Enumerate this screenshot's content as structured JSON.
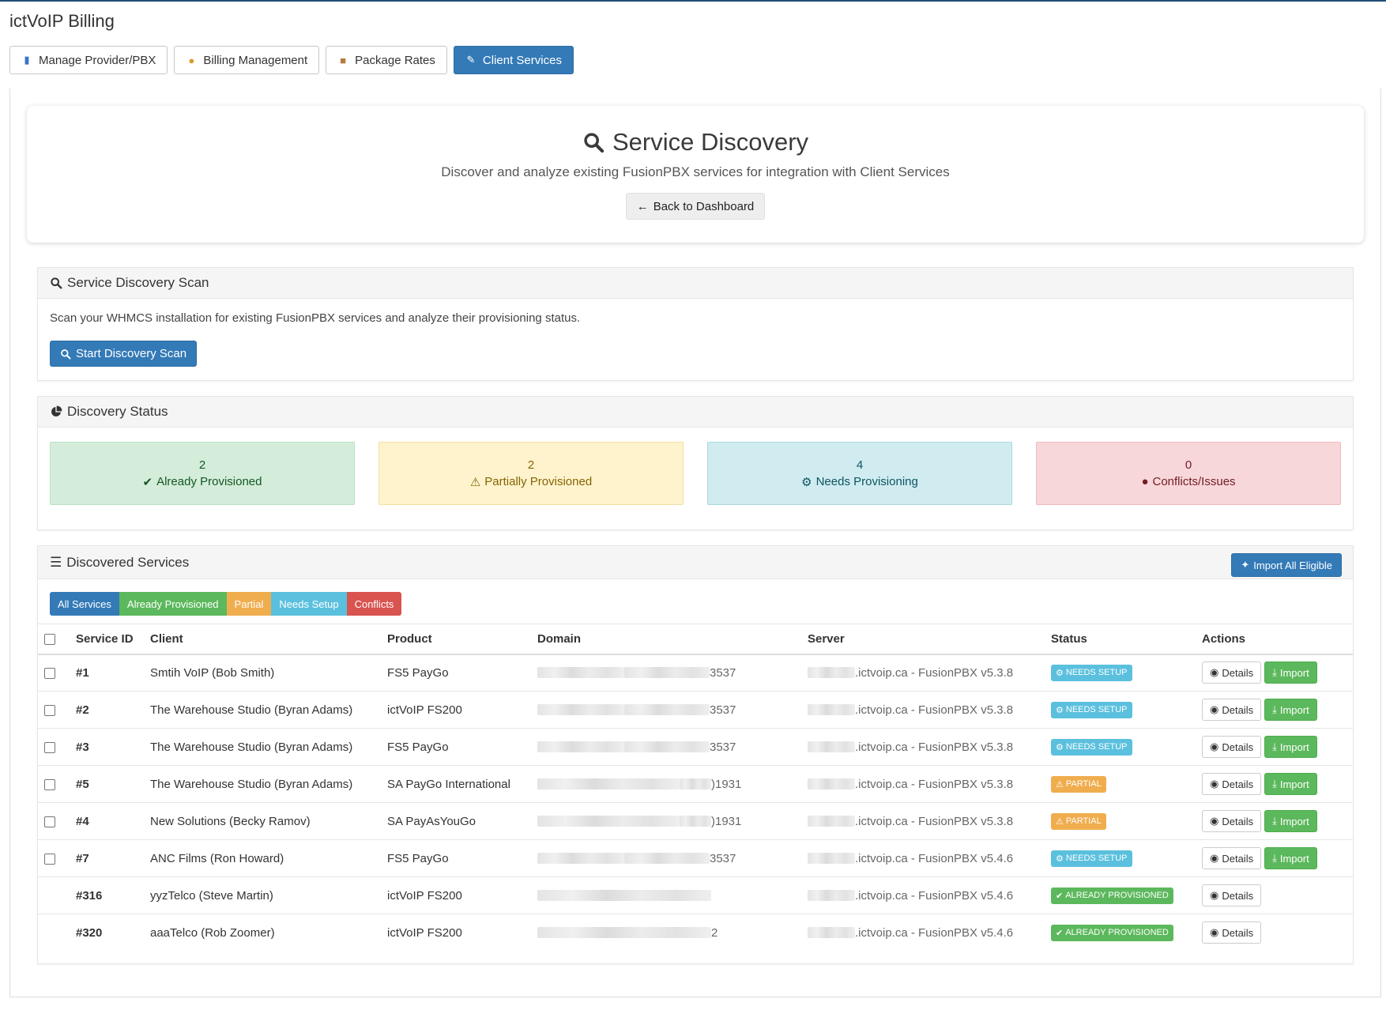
{
  "app_title": "ictVoIP Billing",
  "nav": {
    "tabs": [
      {
        "label": "Manage Provider/PBX",
        "icon": "bar-chart-icon"
      },
      {
        "label": "Billing Management",
        "icon": "money-bag-icon"
      },
      {
        "label": "Package Rates",
        "icon": "package-icon"
      },
      {
        "label": "Client Services",
        "icon": "wrench-icon",
        "active": true
      }
    ]
  },
  "hero": {
    "title": "Service Discovery",
    "subtitle": "Discover and analyze existing FusionPBX services for integration with Client Services",
    "back_label": "Back to Dashboard"
  },
  "scan": {
    "title": "Service Discovery Scan",
    "description": "Scan your WHMCS installation for existing FusionPBX services and analyze their provisioning status.",
    "button_label": "Start Discovery Scan"
  },
  "status": {
    "title": "Discovery Status",
    "cards": [
      {
        "count": "2",
        "label": "Already Provisioned",
        "color": "#d4edda"
      },
      {
        "count": "2",
        "label": "Partially Provisioned",
        "color": "#fff3cd"
      },
      {
        "count": "4",
        "label": "Needs Provisioning",
        "color": "#d1ecf1"
      },
      {
        "count": "0",
        "label": "Conflicts/Issues",
        "color": "#f8d7da"
      }
    ]
  },
  "services": {
    "title": "Discovered Services",
    "import_all_label": "Import All Eligible",
    "filters": [
      "All Services",
      "Already Provisioned",
      "Partial",
      "Needs Setup",
      "Conflicts"
    ],
    "columns": [
      "Service ID",
      "Client",
      "Product",
      "Domain",
      "Server",
      "Status",
      "Actions"
    ],
    "details_label": "Details",
    "import_label": "Import",
    "rows": [
      {
        "id": "#1",
        "client": "Smtih VoIP (Bob Smith)",
        "product": "FS5 PayGo",
        "domain_suffix": "3537",
        "server": ".ictvoip.ca - FusionPBX v5.3.8",
        "status": "NEEDS SETUP",
        "status_type": "needs",
        "checkbox": true,
        "import": true
      },
      {
        "id": "#2",
        "client": "The Warehouse Studio (Byran Adams)",
        "product": "ictVoIP FS200",
        "domain_suffix": "3537",
        "server": ".ictvoip.ca - FusionPBX v5.3.8",
        "status": "NEEDS SETUP",
        "status_type": "needs",
        "checkbox": true,
        "import": true
      },
      {
        "id": "#3",
        "client": "The Warehouse Studio (Byran Adams)",
        "product": "FS5 PayGo",
        "domain_suffix": "3537",
        "server": ".ictvoip.ca - FusionPBX v5.3.8",
        "status": "NEEDS SETUP",
        "status_type": "needs",
        "checkbox": true,
        "import": true
      },
      {
        "id": "#5",
        "client": "The Warehouse Studio (Byran Adams)",
        "product": "SA PayGo International",
        "domain_suffix": ")1931",
        "server": ".ictvoip.ca - FusionPBX v5.3.8",
        "status": "PARTIAL",
        "status_type": "partial",
        "checkbox": true,
        "import": true
      },
      {
        "id": "#4",
        "client": "New Solutions (Becky Ramov)",
        "product": "SA PayAsYouGo",
        "domain_suffix": ")1931",
        "server": ".ictvoip.ca - FusionPBX v5.3.8",
        "status": "PARTIAL",
        "status_type": "partial",
        "checkbox": true,
        "import": true
      },
      {
        "id": "#7",
        "client": "ANC Films (Ron Howard)",
        "product": "FS5 PayGo",
        "domain_suffix": "3537",
        "server": ".ictvoip.ca - FusionPBX v5.4.6",
        "status": "NEEDS SETUP",
        "status_type": "needs",
        "checkbox": true,
        "import": true
      },
      {
        "id": "#316",
        "client": "yyzTelco (Steve Martin)",
        "product": "ictVoIP FS200",
        "domain_suffix": "",
        "server": ".ictvoip.ca - FusionPBX v5.4.6",
        "status": "ALREADY PROVISIONED",
        "status_type": "done",
        "checkbox": false,
        "import": false
      },
      {
        "id": "#320",
        "client": "aaaTelco (Rob Zoomer)",
        "product": "ictVoIP FS200",
        "domain_suffix": "2",
        "server": ".ictvoip.ca - FusionPBX v5.4.6",
        "status": "ALREADY PROVISIONED",
        "status_type": "done",
        "checkbox": false,
        "import": false
      }
    ]
  },
  "colors": {
    "primary": "#337ab7",
    "success": "#5cb85c",
    "warning": "#f0ad4e",
    "info": "#5bc0de",
    "danger": "#d9534f"
  }
}
